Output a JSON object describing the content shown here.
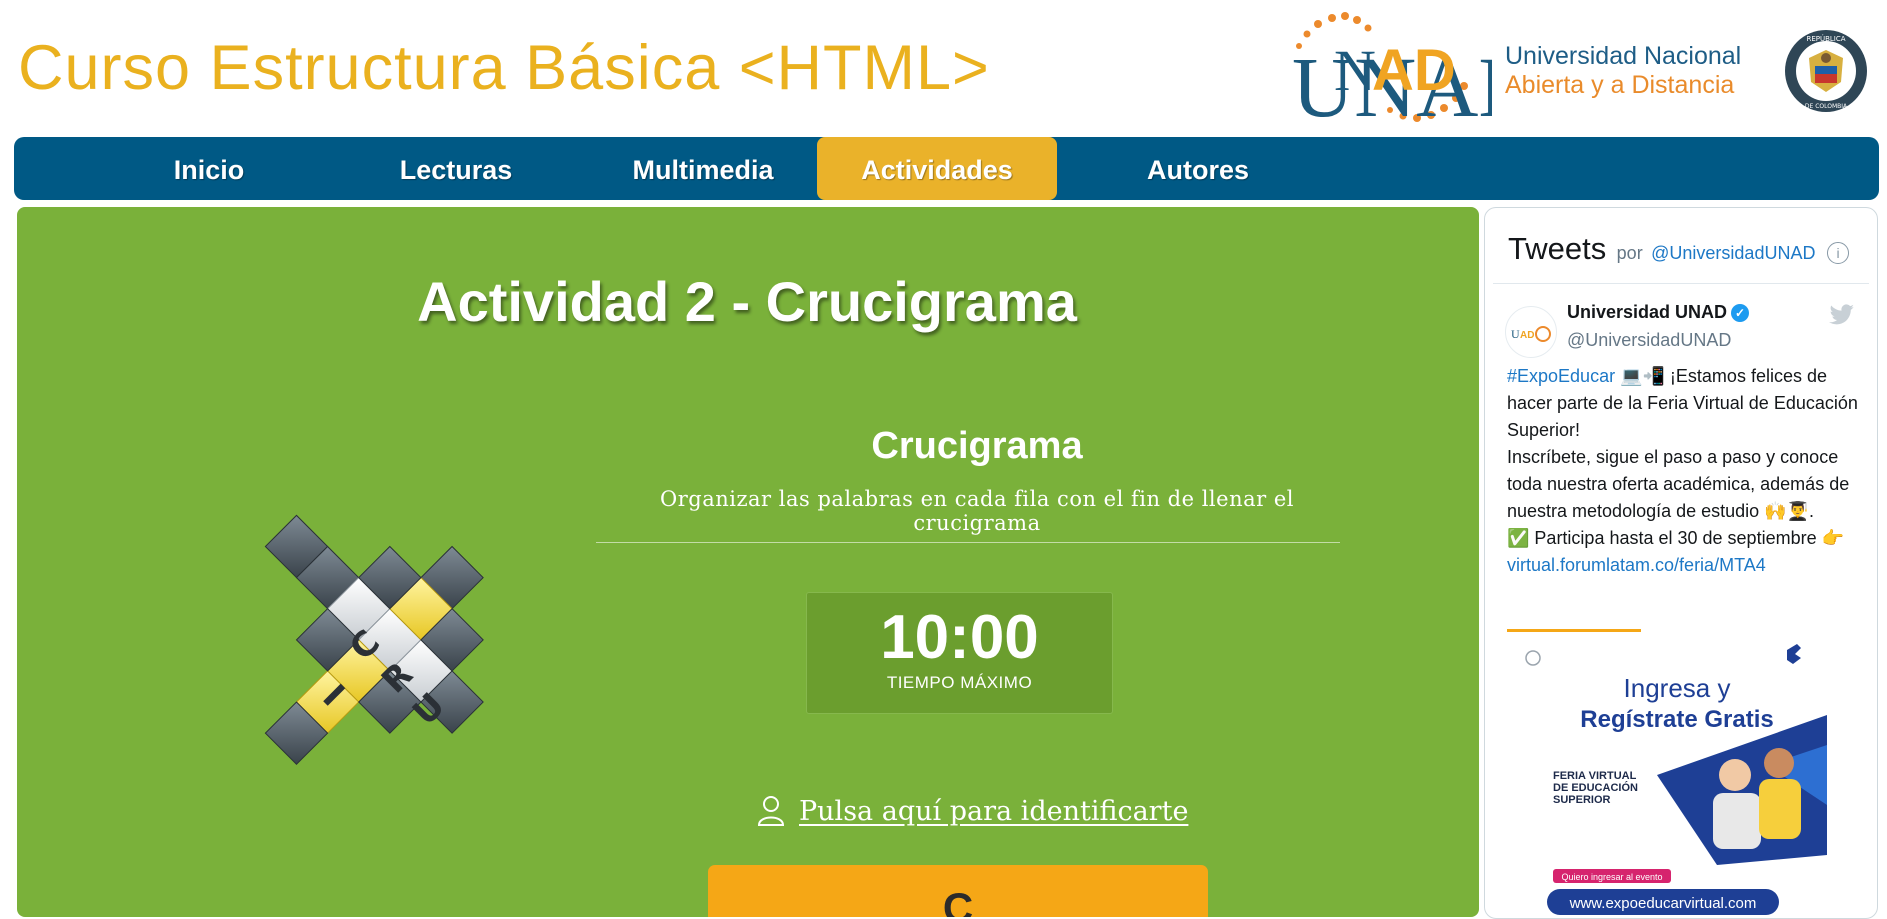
{
  "header": {
    "title": "Curso Estructura Básica <HTML>",
    "logo_text": "UNAD",
    "university_line1": "Universidad Nacional",
    "university_line2": "Abierta y a Distancia",
    "seal_top": "REPÚBLICA",
    "seal_bottom": "DE COLOMBIA"
  },
  "nav": {
    "items": [
      {
        "label": "Inicio"
      },
      {
        "label": "Lecturas"
      },
      {
        "label": "Multimedia"
      },
      {
        "label": "Actividades"
      },
      {
        "label": "Autores"
      }
    ],
    "active": "Actividades"
  },
  "activity": {
    "title": "Actividad 2 - Crucigrama",
    "game_title": "Crucigrama",
    "description": "Organizar las palabras en cada fila con el fin de llenar el crucigrama",
    "timer_value": "10:00",
    "timer_label": "TIEMPO MÁXIMO",
    "login_text": "Pulsa aquí para identificarte",
    "start_button": "C",
    "illustration_letters": [
      "C",
      "R",
      "U",
      "I"
    ]
  },
  "twitter": {
    "heading": "Tweets",
    "by": "por",
    "handle_link": "@UniversidadUNAD",
    "tweet": {
      "name": "Universidad UNAD",
      "handle": "@UniversidadUNAD",
      "hashtag": "#ExpoEducar",
      "emoji1": "💻📲",
      "text1": " ¡Estamos felices de hacer parte de la Feria Virtual de Educación Superior!",
      "text2": "Inscríbete, sigue el paso a paso y conoce toda nuestra oferta académica, además de nuestra metodología de estudio ",
      "emoji2": "🙌👨‍🎓",
      "text2_end": ".",
      "text3_prefix": "✅ ",
      "text3": "Participa hasta el 30 de septiembre ",
      "emoji3": "👉",
      "link": "virtual.forumlatam.co/feria/MTA4"
    },
    "media": {
      "headline1": "Ingresa y",
      "headline2": "Regístrate Gratis",
      "event_line1": "FERIA VIRTUAL",
      "event_line2": "DE EDUCACIÓN",
      "event_line3": "SUPERIOR",
      "cta": "Quiero ingresar al evento",
      "url": "www.expoeducarvirtual.com"
    }
  },
  "colors": {
    "title_gold": "#eab11f",
    "nav_blue": "#005985",
    "nav_active": "#eab22a",
    "main_green": "#7ab13a",
    "button_orange": "#f5a716"
  }
}
